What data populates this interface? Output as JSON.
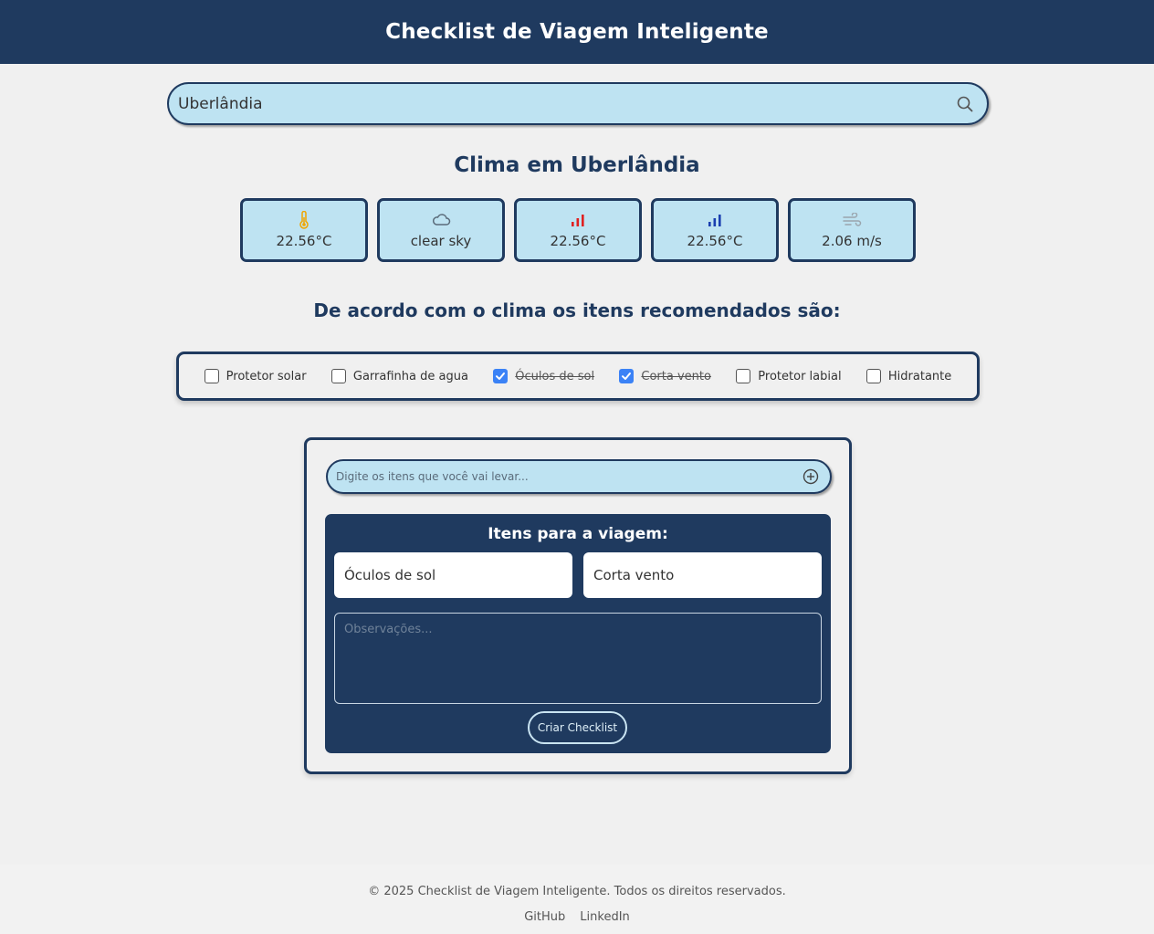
{
  "header": {
    "title": "Checklist de Viagem Inteligente"
  },
  "search": {
    "value": "Uberlândia",
    "icon": "search-icon"
  },
  "weather": {
    "title": "Clima em Uberlândia",
    "cards": [
      {
        "icon": "thermometer-icon",
        "value": "22.56°C",
        "color": "#f0a500"
      },
      {
        "icon": "cloud-icon",
        "value": "clear sky",
        "color": "#5a6b7a"
      },
      {
        "icon": "signal-high-icon",
        "value": "22.56°C",
        "color": "#e02020"
      },
      {
        "icon": "signal-low-icon",
        "value": "22.56°C",
        "color": "#1a3fb0"
      },
      {
        "icon": "wind-icon",
        "value": "2.06 m/s",
        "color": "#9aa5ad"
      }
    ]
  },
  "recommendations": {
    "title": "De acordo com o clima os itens recomendados são:",
    "items": [
      {
        "label": "Protetor solar",
        "checked": false
      },
      {
        "label": "Garrafinha de agua",
        "checked": false
      },
      {
        "label": "Óculos de sol",
        "checked": true
      },
      {
        "label": "Corta vento",
        "checked": true
      },
      {
        "label": "Protetor labial",
        "checked": false
      },
      {
        "label": "Hidratante",
        "checked": false
      }
    ]
  },
  "checklist": {
    "input_placeholder": "Digite os itens que você vai levar...",
    "add_icon": "plus-circle-icon",
    "title": "Itens para a viagem:",
    "items": [
      "Óculos de sol",
      "Corta vento"
    ],
    "notes_placeholder": "Observações...",
    "create_label": "Criar Checklist"
  },
  "footer": {
    "copyright": "© 2025 Checklist de Viagem Inteligente. Todos os direitos reservados.",
    "links": [
      "GitHub",
      "LinkedIn"
    ]
  },
  "colors": {
    "primary": "#1f3a5f",
    "input_bg": "#bee3f2",
    "background": "#f0f0f0",
    "checkbox": "#3b82f6"
  }
}
